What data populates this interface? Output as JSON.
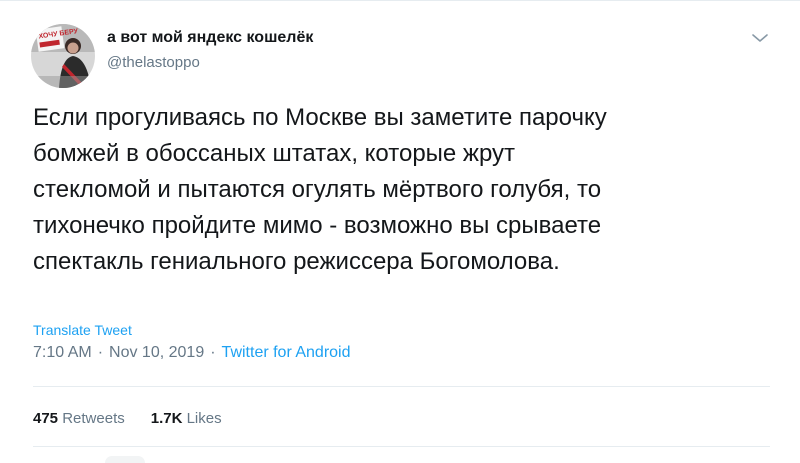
{
  "author": {
    "display_name": "а вот мой яндекс кошелёк",
    "handle": "@thelastoppo",
    "avatar_sign_text": "ХОЧУ БЕРУ"
  },
  "menu": {
    "caret_icon": "chevron-down-icon"
  },
  "tweet": {
    "text": "Если прогуливаясь по Москве вы заметите парочку\nбомжей в обоссаных штатах, которые жрут\nстекломой и пытаются огулять мёртвого голубя, то\nтихонечко пройдите мимо - возможно вы срываете\nспектакль гениального режиссера Богомолова.",
    "translate_label": "Translate Tweet",
    "time": "7:10 AM",
    "date": "Nov 10, 2019",
    "separator": "·",
    "source": "Twitter for Android"
  },
  "stats": {
    "retweets_count": "475",
    "retweets_label": "Retweets",
    "likes_count": "1.7K",
    "likes_label": "Likes"
  },
  "colors": {
    "link": "#1da1f2",
    "text": "#14171a",
    "secondary": "#657786",
    "divider": "#e6ecf0"
  }
}
